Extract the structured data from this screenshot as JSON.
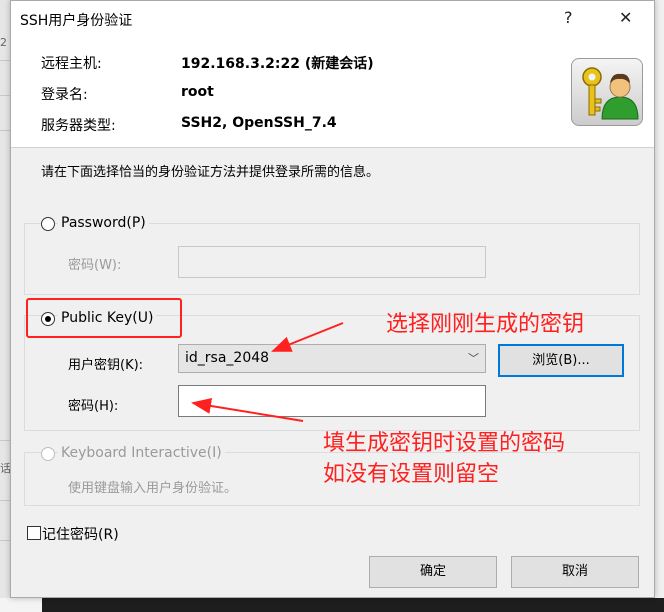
{
  "window": {
    "title": "SSH用户身份验证",
    "help_label": "?",
    "close_label": "✕"
  },
  "info": {
    "host_label": "远程主机:",
    "host_value": "192.168.3.2:22 (新建会话)",
    "login_label": "登录名:",
    "login_value": "root",
    "server_type_label": "服务器类型:",
    "server_type_value": "SSH2, OpenSSH_7.4",
    "icon": "key-user-icon"
  },
  "instruction": "请在下面选择恰当的身份验证方法并提供登录所需的信息。",
  "password_method": {
    "label": "Password(P)",
    "checked": false,
    "field_label": "密码(W):",
    "field_value": ""
  },
  "public_key_method": {
    "label": "Public Key(U)",
    "checked": true,
    "user_key_label": "用户密钥(K):",
    "user_key_value": "id_rsa_2048",
    "browse_label": "浏览(B)...",
    "passphrase_label": "密码(H):",
    "passphrase_value": ""
  },
  "keyboard_method": {
    "label": "Keyboard Interactive(I)",
    "checked": false,
    "enabled": false,
    "description": "使用键盘输入用户身份验证。"
  },
  "remember_password": {
    "label": "记住密码(R)",
    "checked": false
  },
  "buttons": {
    "ok": "确定",
    "cancel": "取消"
  },
  "annotations": {
    "select_key": "选择刚刚生成的密钥",
    "passphrase_line1": "填生成密钥时设置的密码",
    "passphrase_line2": "如没有设置则留空",
    "color": "#ff2020"
  },
  "background": {
    "left_fragment_1": "2",
    "left_fragment_2": "话"
  }
}
